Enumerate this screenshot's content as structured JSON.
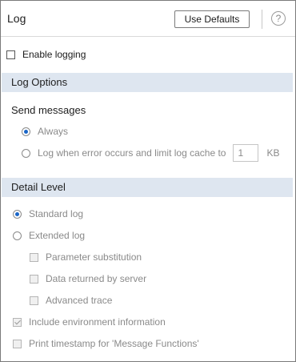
{
  "header": {
    "title": "Log",
    "use_defaults_label": "Use Defaults",
    "help_glyph": "?"
  },
  "enable_logging": {
    "label": "Enable logging",
    "checked": false
  },
  "log_options": {
    "heading": "Log Options",
    "send_messages": {
      "heading": "Send messages",
      "always_label": "Always",
      "always_selected": true,
      "on_error_label": "Log when error occurs and limit log cache to",
      "cache_value": "1",
      "cache_unit": "KB"
    }
  },
  "detail_level": {
    "heading": "Detail Level",
    "standard_label": "Standard log",
    "standard_selected": true,
    "extended_label": "Extended log",
    "param_sub_label": "Parameter substitution",
    "data_returned_label": "Data returned by server",
    "advanced_trace_label": "Advanced trace",
    "include_env_label": "Include environment information",
    "include_env_checked": true,
    "print_timestamp_label": "Print timestamp for 'Message Functions'"
  },
  "colors": {
    "section_bg": "#dee6f0",
    "radio_dot": "#1a66c8",
    "disabled_text": "#8a8a8a"
  }
}
